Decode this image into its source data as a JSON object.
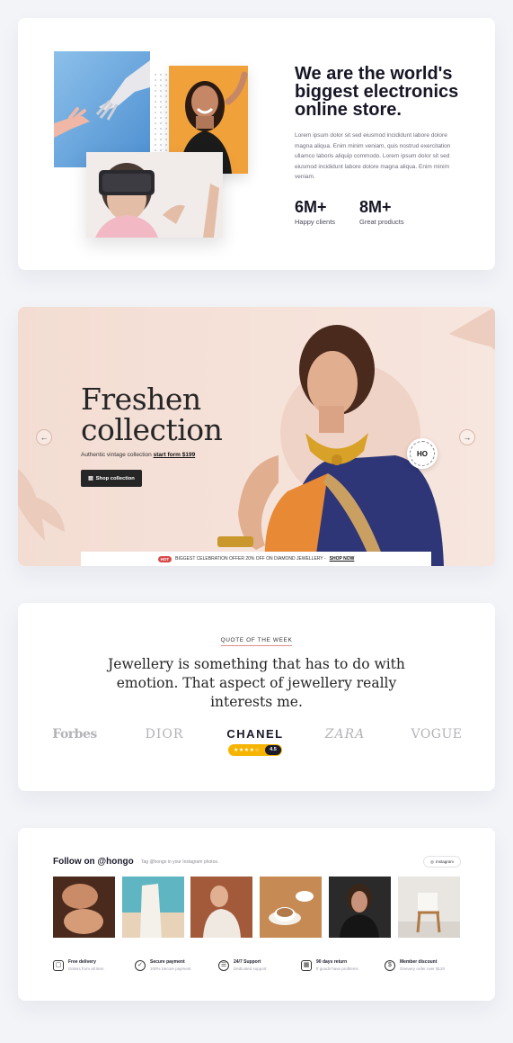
{
  "about": {
    "title": "We are the world's biggest electronics online store.",
    "text": "Lorem ipsum dolor sit sed eiusmod incididunt labore dolore magna aliqua. Enim minim veniam, quis nostrud exercitation ullamco laboris aliquip commodo. Lorem ipsum dolor sit sed eiusmod incididunt labore dolore magna aliqua. Enim minim veniam.",
    "stats": [
      {
        "value": "6M+",
        "label": "Happy clients"
      },
      {
        "value": "8M+",
        "label": "Great products"
      }
    ]
  },
  "hero": {
    "title": "Freshen collection",
    "subtitle": "Authentic vintage collection",
    "subtitle_link": "start form $199",
    "button_label": "Shop collection",
    "prev_arrow": "←",
    "next_arrow": "→",
    "badge_text": "HO",
    "promo_tag": "HOT",
    "promo_text": "BIGGEST CELEBRATION OFFER 20% OFF ON DIAMOND JEWELLERY -",
    "promo_link": "SHOP NOW"
  },
  "quote": {
    "label": "QUOTE OF THE WEEK",
    "text": "Jewellery is something that has to do with emotion. That aspect of jewellery really interests me.",
    "brands": [
      "Forbes",
      "DIOR",
      "CHANEL",
      "ZARA",
      "VOGUE"
    ],
    "rating_stars": "★★★★☆",
    "rating_score": "4.5"
  },
  "instagram": {
    "title": "Follow on @hongo",
    "subtitle": "Tag @hongo in your Instagram photos.",
    "button_label": "Instagram",
    "features": [
      {
        "icon": "box-icon",
        "glyph": "▢",
        "title": "Free delivery",
        "text": "Orders from all item"
      },
      {
        "icon": "check-circle-icon",
        "glyph": "✓",
        "title": "Secure payment",
        "text": "100% Secure payment"
      },
      {
        "icon": "chat-icon",
        "glyph": "☰",
        "title": "24/7 Support",
        "text": "Dedicated support"
      },
      {
        "icon": "calendar-icon",
        "glyph": "▦",
        "title": "90 days return",
        "text": "If goods have problems"
      },
      {
        "icon": "dollar-icon",
        "glyph": "$",
        "title": "Member discount",
        "text": "Onevery order over $120"
      }
    ]
  },
  "colors": {
    "page_bg": "#f3f4f8",
    "hero_bg": "#f5e1d8",
    "accent_red": "#d84a4a",
    "rating_yellow": "#f6b400"
  }
}
